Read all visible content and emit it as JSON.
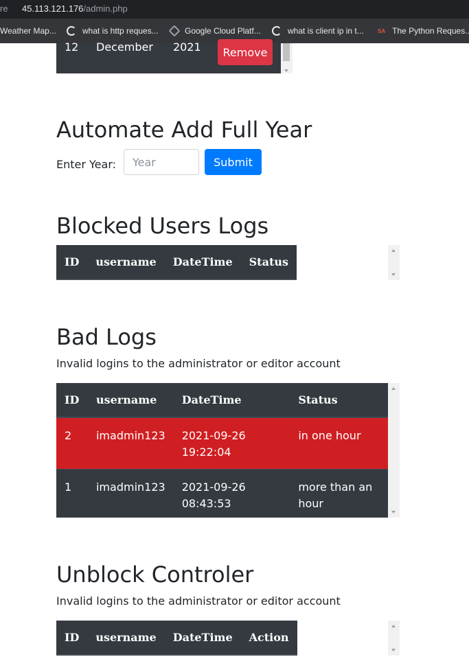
{
  "browser": {
    "address_prefix": "re",
    "host": "45.113.121.176",
    "path": "/admin.php",
    "bookmarks": [
      {
        "label": "Weather Map...",
        "icon": ""
      },
      {
        "label": "what is http reques...",
        "icon": "google-icon"
      },
      {
        "label": "Google Cloud Platf...",
        "icon": "cloud-icon"
      },
      {
        "label": "what is client ip in t...",
        "icon": "google-icon"
      },
      {
        "label": "The Python Reques...",
        "icon": "sa-icon"
      }
    ],
    "sa_glyph": "SA"
  },
  "top_row": {
    "day": "12",
    "month": "December",
    "year": "2021",
    "remove_label": "Remove"
  },
  "automate": {
    "heading": "Automate Add Full Year",
    "label": "Enter Year:",
    "placeholder": "Year",
    "submit_label": "Submit"
  },
  "blocked": {
    "heading": "Blocked Users Logs",
    "headers": [
      "ID",
      "username",
      "DateTime",
      "Status"
    ]
  },
  "bad_logs": {
    "heading": "Bad Logs",
    "subtitle": "Invalid logins to the administrator or editor account",
    "headers": [
      "ID",
      "username",
      "DateTime",
      "Status"
    ],
    "rows": [
      {
        "id": "2",
        "username": "imadmin123",
        "datetime": "2021-09-26 19:22:04",
        "status": "in one hour",
        "highlight": true
      },
      {
        "id": "1",
        "username": "imadmin123",
        "datetime": "2021-09-26 08:43:53",
        "status": "more than an hour",
        "highlight": false
      }
    ]
  },
  "unblock": {
    "heading": "Unblock Controler",
    "subtitle": "Invalid logins to the administrator or editor account",
    "headers": [
      "ID",
      "username",
      "DateTime",
      "Action"
    ]
  },
  "colors": {
    "danger_row": "#d01f22",
    "table_dark": "#343a40",
    "primary": "#007bff",
    "remove": "#dc3545"
  }
}
